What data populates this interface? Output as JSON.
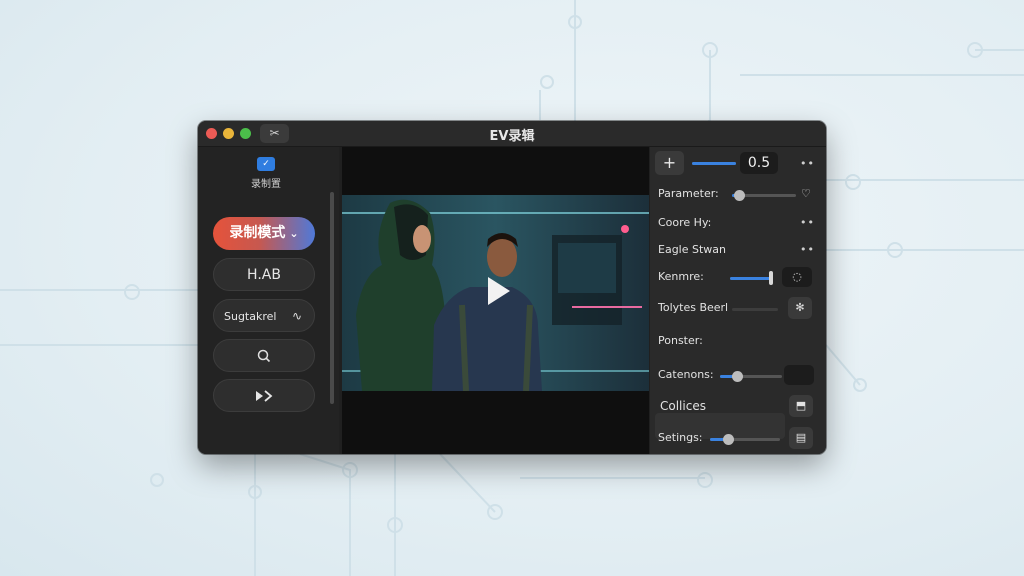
{
  "window": {
    "title": "EV录辑",
    "tool_icon": "scissors-icon",
    "traffic_lights": [
      "#ec5b55",
      "#e9b53a",
      "#4bbf4a"
    ]
  },
  "sidebar": {
    "logo_icon": "app-logo-icon",
    "caption": "录制置",
    "buttons": [
      {
        "label": "录制模式",
        "icon": "chevron-down-icon"
      },
      {
        "label": "H.AB"
      },
      {
        "label": "Sugtakrel",
        "icon": "waveform-icon"
      },
      {
        "icon": "search-icon"
      },
      {
        "icon": "fast-forward-icon"
      }
    ]
  },
  "player": {
    "play_icon": "play-icon"
  },
  "panel": {
    "top_value": "0.5",
    "top_slider_percent": 100,
    "add_icon": "plus-icon",
    "rows": [
      {
        "label": "Parameter:",
        "slider_percent": 8,
        "icon": "heart-icon"
      },
      {
        "label": "Coore Hy:"
      },
      {
        "label": "Eagle Stwan"
      },
      {
        "label": "Kenmre:",
        "slider_percent": 100,
        "icon": "tag-icon"
      },
      {
        "label": "Tolytes Beerl",
        "icon": "fan-icon"
      },
      {
        "label": "Ponster:"
      },
      {
        "label": "Catenons:",
        "slider_percent": 30
      },
      {
        "label": "Collices",
        "icon": "export-icon"
      },
      {
        "label": "Setings:",
        "slider_percent": 25,
        "icon": "save-icon"
      }
    ],
    "accent": "#3a82e0"
  }
}
